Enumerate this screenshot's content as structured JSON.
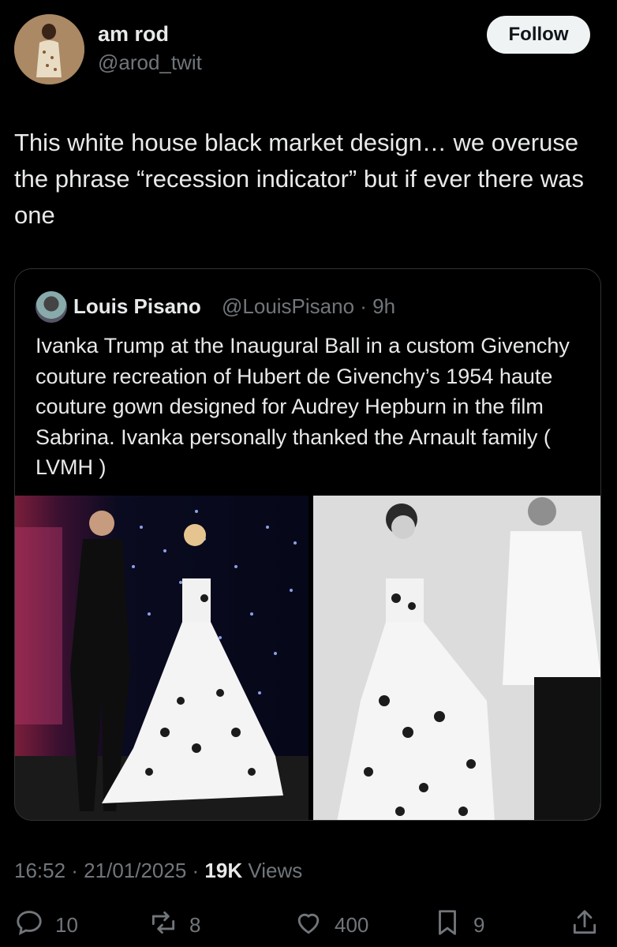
{
  "author": {
    "name": "am rod",
    "handle": "@arod_twit",
    "follow_label": "Follow"
  },
  "tweet_text": "This white house black market design… we overuse the phrase “recession indicator” but if ever there was one",
  "quoted": {
    "name": "Louis Pisano",
    "handle_time": "@LouisPisano · 9h",
    "text": "Ivanka Trump at the Inaugural Ball in a custom Givenchy couture recreation of Hubert de Givenchy’s 1954 haute couture gown designed for Audrey Hepburn in the film Sabrina. Ivanka personally thanked the Arnault family ( LVMH )"
  },
  "meta": {
    "time_date": "16:52 · 21/01/2025 · ",
    "views_count": "19K",
    "views_label": " Views"
  },
  "actions": {
    "replies": "10",
    "reposts": "8",
    "likes": "400",
    "bookmarks": "9"
  },
  "icons": [
    "reply-icon",
    "repost-icon",
    "like-icon",
    "bookmark-icon",
    "share-icon"
  ],
  "colors": {
    "background": "#000000",
    "text": "#e7e9ea",
    "muted": "#71767b",
    "border": "#2f3336"
  }
}
